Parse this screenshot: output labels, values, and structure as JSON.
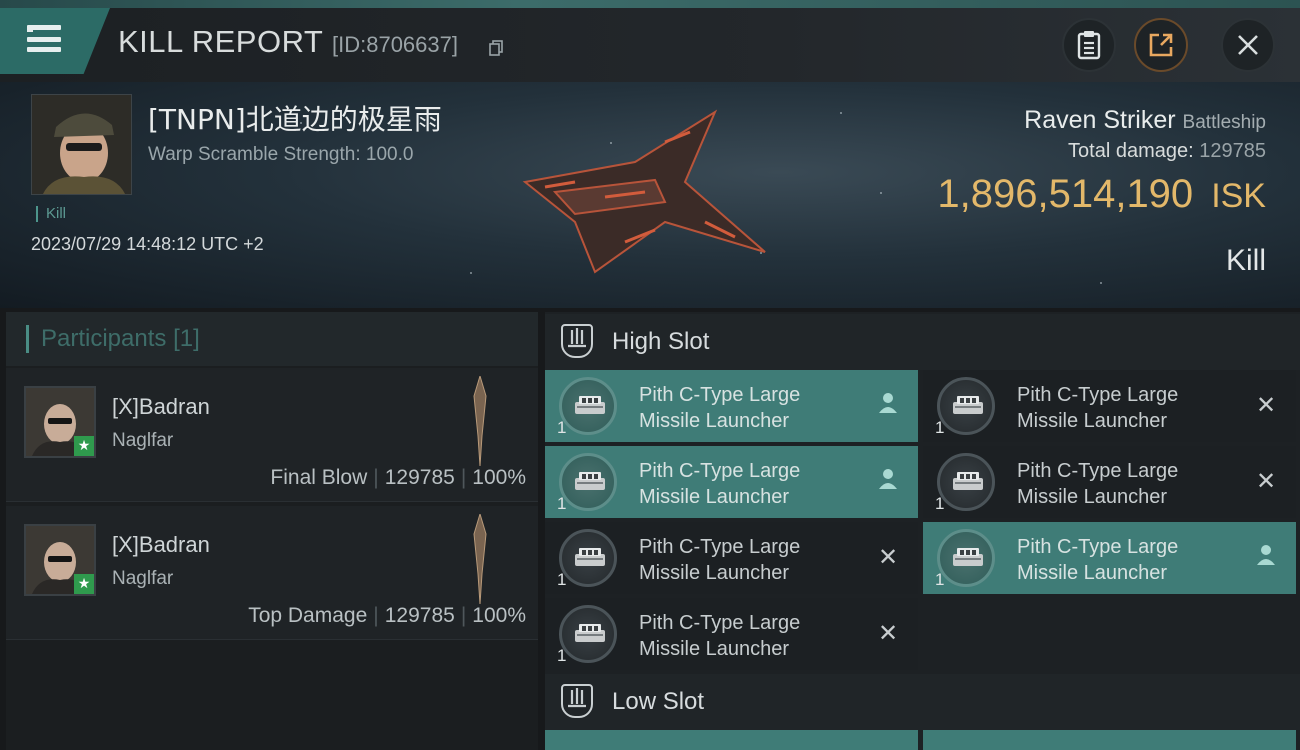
{
  "header": {
    "title": "KILL REPORT",
    "report_id": "[ID:8706637]"
  },
  "victim": {
    "pilot_name": "[TNPN]北道边的极星雨",
    "warp_scramble": "Warp Scramble Strength: 100.0",
    "tag": "Kill",
    "datetime": "2023/07/29 14:48:12 UTC +2",
    "ship_name": "Raven Striker",
    "ship_class": "Battleship",
    "total_damage_label": "Total damage:",
    "total_damage_value": "129785",
    "isk_value": "1,896,514,190",
    "isk_unit": "ISK",
    "result": "Kill"
  },
  "participants": {
    "title": "Participants",
    "count": "[1]",
    "items": [
      {
        "name": "[X]Badran",
        "ship": "Naglfar",
        "role": "Final Blow",
        "damage": "129785",
        "percent": "100%"
      },
      {
        "name": "[X]Badran",
        "ship": "Naglfar",
        "role": "Top Damage",
        "damage": "129785",
        "percent": "100%"
      }
    ]
  },
  "slots": {
    "high": {
      "title": "High Slot",
      "modules": [
        {
          "line1": "Pith C-Type Large",
          "line2": "Missile Launcher",
          "qty": "1",
          "status": "pilot",
          "highlighted": true
        },
        {
          "line1": "Pith C-Type Large",
          "line2": "Missile Launcher",
          "qty": "1",
          "status": "destroyed",
          "highlighted": false
        },
        {
          "line1": "Pith C-Type Large",
          "line2": "Missile Launcher",
          "qty": "1",
          "status": "pilot",
          "highlighted": true
        },
        {
          "line1": "Pith C-Type Large",
          "line2": "Missile Launcher",
          "qty": "1",
          "status": "destroyed",
          "highlighted": false
        },
        {
          "line1": "Pith C-Type Large",
          "line2": "Missile Launcher",
          "qty": "1",
          "status": "destroyed",
          "highlighted": false
        },
        {
          "line1": "Pith C-Type Large",
          "line2": "Missile Launcher",
          "qty": "1",
          "status": "pilot",
          "highlighted": true
        },
        {
          "line1": "Pith C-Type Large",
          "line2": "Missile Launcher",
          "qty": "1",
          "status": "destroyed",
          "highlighted": false
        }
      ]
    },
    "low": {
      "title": "Low Slot"
    }
  },
  "colors": {
    "accent_teal": "#3f7c77",
    "isk_gold": "#e3b86a",
    "badge_green": "#2f9a4d"
  }
}
